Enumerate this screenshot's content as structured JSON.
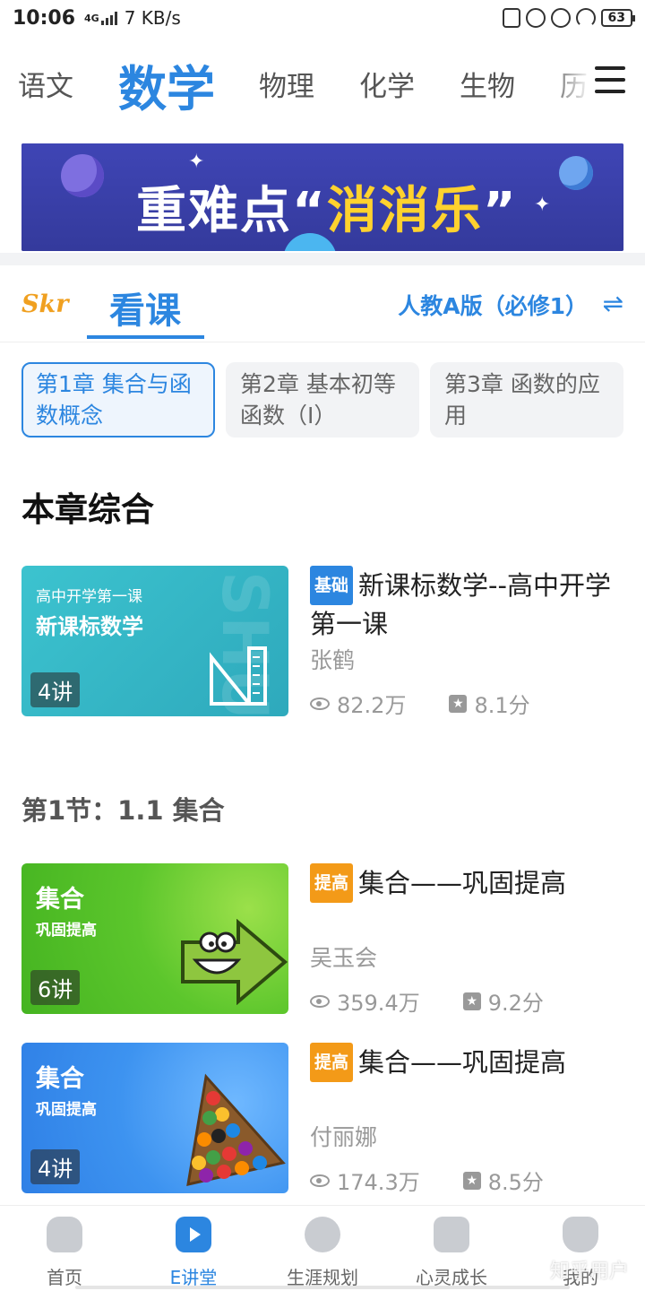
{
  "status_bar": {
    "time": "10:06",
    "network": "4G",
    "speed": "7 KB/s",
    "battery": "63"
  },
  "subjects": {
    "items": [
      "语文",
      "数学",
      "物理",
      "化学",
      "生物",
      "历"
    ],
    "active": "数学"
  },
  "banner": {
    "title_white": "重难点“",
    "title_yellow": "消消乐",
    "title_end": "”"
  },
  "course_tabs": {
    "brand": "Skr",
    "active_tab": "看课",
    "edition": "人教A版（必修1）",
    "swap_icon": "⇌"
  },
  "chapters": [
    {
      "label": "第1章 集合与函数概念",
      "active": true
    },
    {
      "label": "第2章 基本初等函数（Ⅰ）",
      "active": false
    },
    {
      "label": "第3章 函数的应用",
      "active": false
    }
  ],
  "section_title": "本章综合",
  "subsection_title": "第1节：1.1 集合",
  "courses": [
    {
      "thumb_line1": "高中开学第一课",
      "thumb_line2": "新课标数学",
      "lessons": "4讲",
      "tag": "基础",
      "tag_color": "#2c86e0",
      "title": "新课标数学--高中开学第一课",
      "teacher": "张鹤",
      "views": "82.2万",
      "score": "8.1分"
    },
    {
      "thumb_line1": "集合",
      "thumb_line2": "巩固提高",
      "lessons": "6讲",
      "tag": "提高",
      "tag_color": "#f39a18",
      "title": "集合——巩固提高",
      "teacher": "吴玉会",
      "views": "359.4万",
      "score": "9.2分"
    },
    {
      "thumb_line1": "集合",
      "thumb_line2": "巩固提高",
      "lessons": "4讲",
      "tag": "提高",
      "tag_color": "#f39a18",
      "title": "集合——巩固提高",
      "teacher": "付丽娜",
      "views": "174.3万",
      "score": "8.5分"
    }
  ],
  "bottom_nav": [
    {
      "label": "首页",
      "icon": "home-icon"
    },
    {
      "label": "E讲堂",
      "icon": "play-icon",
      "active": true
    },
    {
      "label": "生涯规划",
      "icon": "compass-icon"
    },
    {
      "label": "心灵成长",
      "icon": "leaf-icon"
    },
    {
      "label": "我的",
      "icon": "user-icon"
    }
  ],
  "watermark": "知乎用户",
  "colors": {
    "accent": "#2c86e0",
    "orange_tag": "#f39a18",
    "banner_bg": "#3a40a8",
    "banner_yellow": "#ffd22e"
  }
}
